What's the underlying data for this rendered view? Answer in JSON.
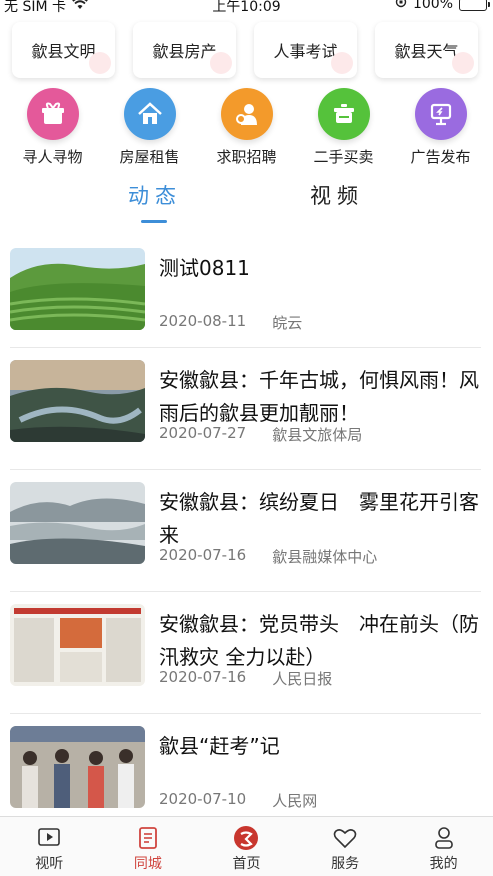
{
  "status": {
    "carrier": "无 SIM 卡",
    "time": "上午10:09",
    "battery": "100%"
  },
  "quick_links": [
    {
      "label": "歙县文明"
    },
    {
      "label": "歙县房产"
    },
    {
      "label": "人事考试"
    },
    {
      "label": "歙县天气"
    }
  ],
  "services": [
    {
      "label": "寻人寻物",
      "icon": "gift-box-icon",
      "color": "#e4599a"
    },
    {
      "label": "房屋租售",
      "icon": "house-icon",
      "color": "#4a9de2"
    },
    {
      "label": "求职招聘",
      "icon": "job-person-icon",
      "color": "#f39a2b"
    },
    {
      "label": "二手买卖",
      "icon": "cooking-pot-icon",
      "color": "#55c23b"
    },
    {
      "label": "广告发布",
      "icon": "billboard-icon",
      "color": "#9a6be0"
    }
  ],
  "tabs": {
    "active": "动态",
    "other": "视频"
  },
  "news": [
    {
      "title": "测试0811",
      "date": "2020-08-11",
      "source": "皖云",
      "thumb": "tea-field"
    },
    {
      "title": "安徽歙县：千年古城，何惧风雨！风雨后的歙县更加靓丽！",
      "date": "2020-07-27",
      "source": "歙县文旅体局",
      "thumb": "river-valley"
    },
    {
      "title": "安徽歙县：缤纷夏日　雾里花开引客来",
      "date": "2020-07-16",
      "source": "歙县融媒体中心",
      "thumb": "misty-mountain"
    },
    {
      "title": "安徽歙县：党员带头　冲在前头（防汛救灾 全力以赴）",
      "date": "2020-07-16",
      "source": "人民日报",
      "thumb": "newspaper"
    },
    {
      "title": "歙县“赶考”记",
      "date": "2020-07-10",
      "source": "人民网",
      "thumb": "crowd"
    }
  ],
  "bottom_nav": [
    {
      "label": "视听",
      "icon": "play-icon",
      "active": false
    },
    {
      "label": "同城",
      "icon": "document-icon",
      "active": true
    },
    {
      "label": "首页",
      "icon": "home-logo-icon",
      "active": false
    },
    {
      "label": "服务",
      "icon": "heart-service-icon",
      "active": false
    },
    {
      "label": "我的",
      "icon": "user-icon",
      "active": false
    }
  ]
}
